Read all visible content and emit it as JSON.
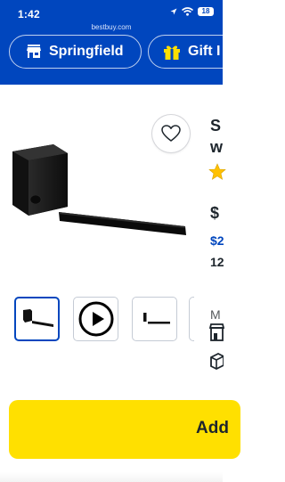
{
  "status_bar": {
    "time": "1:42",
    "battery": "18"
  },
  "browser": {
    "url": "bestbuy.com"
  },
  "header": {
    "store_button_label": "Springfield",
    "gift_button_label": "Gift I"
  },
  "product": {
    "title_fragment_1": "S",
    "title_fragment_2": "w",
    "price_fragment": "$",
    "sale_fragment": "$2",
    "count_fragment": "12",
    "model_fragment": "M"
  },
  "gallery": {
    "thumbnails": [
      {
        "kind": "image",
        "selected": true
      },
      {
        "kind": "video",
        "selected": false
      },
      {
        "kind": "image",
        "selected": false
      },
      {
        "kind": "image",
        "selected": false
      }
    ]
  },
  "actions": {
    "add_to_cart_label": "Add"
  },
  "colors": {
    "brand_blue": "#0046be",
    "cta_yellow": "#ffe000",
    "rating_star": "#ffc100"
  },
  "icons": [
    "wifi-icon",
    "location-icon",
    "store-icon",
    "gift-icon",
    "heart-icon",
    "play-icon",
    "star-icon",
    "delivery-icon",
    "pickup-icon"
  ]
}
